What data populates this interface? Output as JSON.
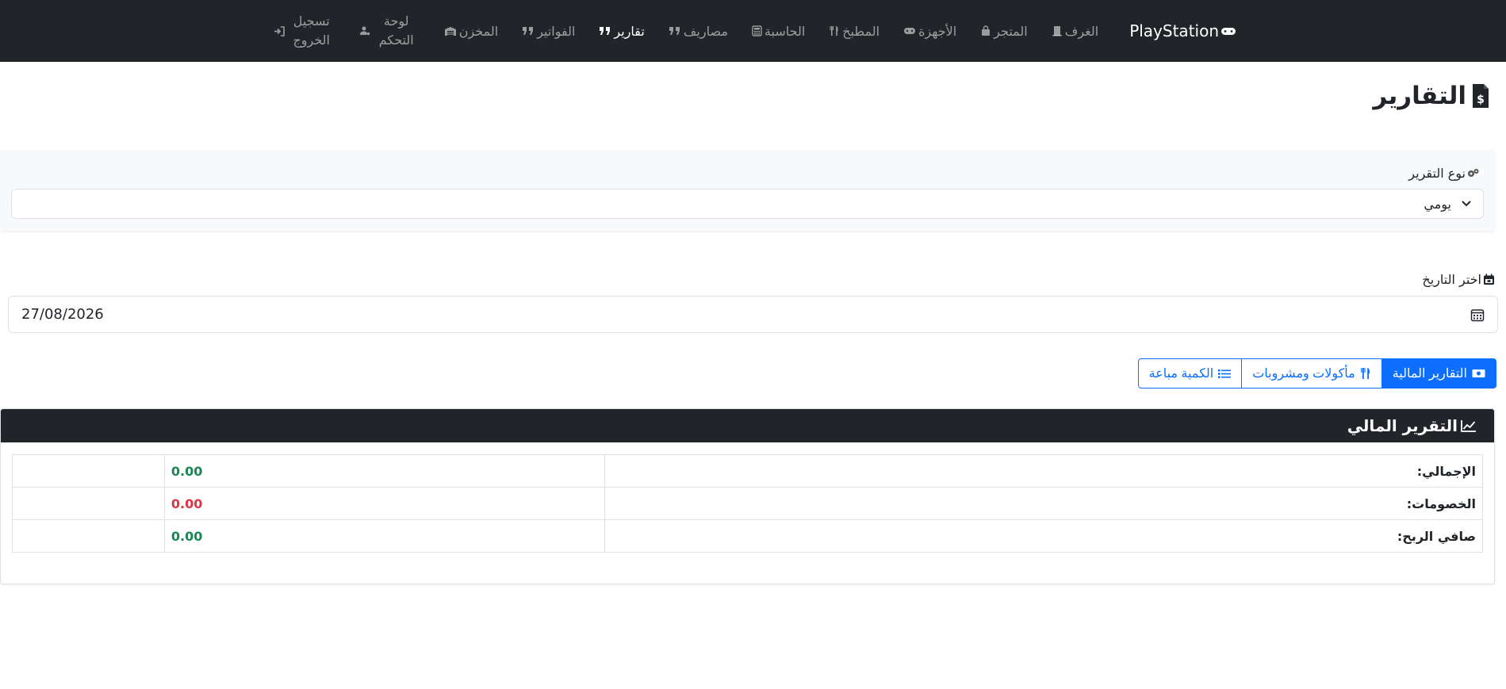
{
  "navbar": {
    "brand": "PlayStation",
    "links": [
      {
        "label": "الغرف",
        "icon": "door-icon"
      },
      {
        "label": "المتجر",
        "icon": "shopping-bag-icon"
      },
      {
        "label": "الأجهزة",
        "icon": "gamepad-icon"
      },
      {
        "label": "المطبخ",
        "icon": "utensils-icon"
      },
      {
        "label": "الحاسبة",
        "icon": "calculator-icon"
      },
      {
        "label": "مصاريف",
        "icon": "quote-icon"
      },
      {
        "label": "تقارير",
        "icon": "quote-icon",
        "active": true
      },
      {
        "label": "الفواتير",
        "icon": "quote-icon"
      },
      {
        "label": "المخزن",
        "icon": "warehouse-icon"
      },
      {
        "label": "لوحة التحكم",
        "icon": "user-gear-icon"
      },
      {
        "label": "تسجيل الخروج",
        "icon": "logout-icon"
      }
    ]
  },
  "page": {
    "title": "التقارير",
    "title_icon": "file-invoice-dollar-icon"
  },
  "report_type": {
    "label": "نوع التقرير",
    "selected": "يومي"
  },
  "date": {
    "label": "اختر التاريخ",
    "value": "27/08/2026"
  },
  "tabs": {
    "financial": "التقارير المالية",
    "food": "مأكولات ومشروبات",
    "quantity": "الكمية مباعة"
  },
  "financial_report": {
    "title": "التقرير المالي",
    "rows": [
      {
        "label": "الإجمالي:",
        "value": "0.00",
        "color": "#198754"
      },
      {
        "label": "الخصومات:",
        "value": "0.00",
        "color": "#dc3545"
      },
      {
        "label": "صافي الربح:",
        "value": "0.00",
        "color": "#198754"
      }
    ]
  },
  "colors": {
    "navbar_bg": "#212529",
    "primary": "#0d6efd",
    "success": "#198754",
    "danger": "#dc3545"
  }
}
